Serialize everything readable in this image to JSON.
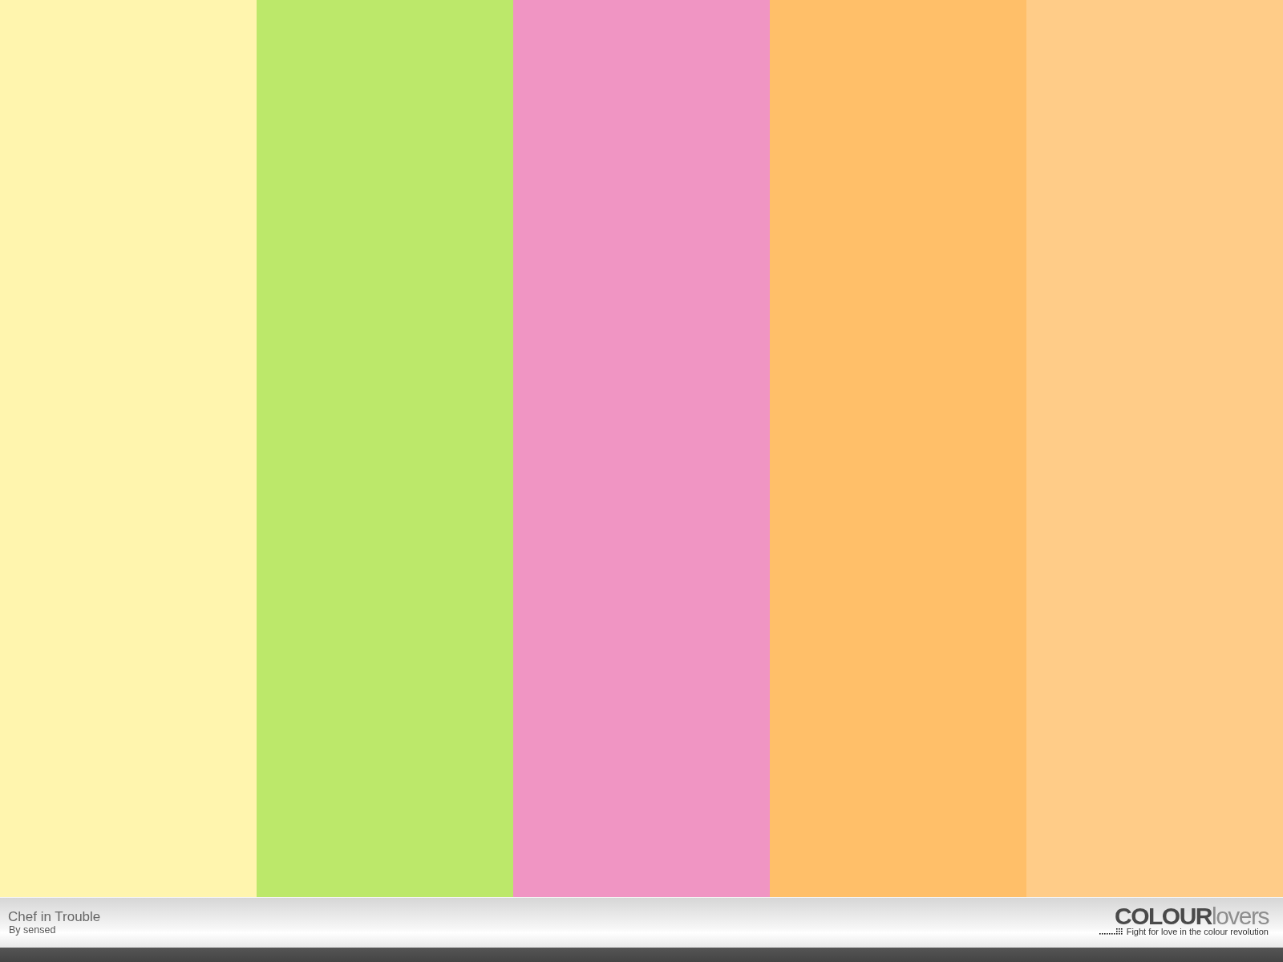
{
  "swatches": [
    {
      "color": "#fff5ae"
    },
    {
      "color": "#bce86a"
    },
    {
      "color": "#f095c3"
    },
    {
      "color": "#ffbf69"
    },
    {
      "color": "#ffcc88"
    }
  ],
  "footer": {
    "title": "Chef in Trouble",
    "author": "By sensed",
    "logo": {
      "bold": "COLOUR",
      "light": "lovers"
    },
    "tagline": "Fight for love in the colour revolution"
  }
}
